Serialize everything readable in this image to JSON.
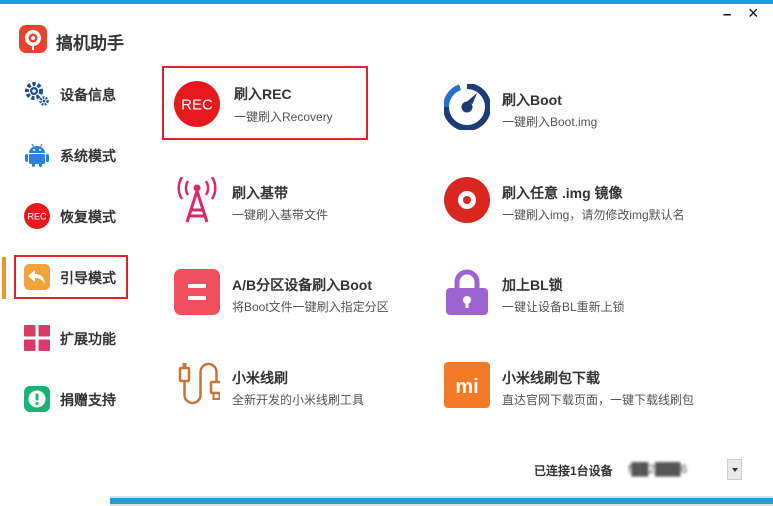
{
  "app": {
    "title": "搞机助手"
  },
  "window": {
    "minimize_label": "–",
    "close_label": "×"
  },
  "sidebar": {
    "items": [
      {
        "label": "设备信息",
        "icon": "gear-icon"
      },
      {
        "label": "系统模式",
        "icon": "android-icon"
      },
      {
        "label": "恢复模式",
        "icon": "rec-icon",
        "icon_text": "REC"
      },
      {
        "label": "引导模式",
        "icon": "back-arrow-icon",
        "active": true
      },
      {
        "label": "扩展功能",
        "icon": "grid-icon"
      },
      {
        "label": "捐赠支持",
        "icon": "info-icon"
      }
    ]
  },
  "cards": [
    {
      "title": "刷入REC",
      "desc": "一键刷入Recovery",
      "icon": "rec-icon",
      "icon_text": "REC",
      "selected": true
    },
    {
      "title": "刷入Boot",
      "desc": "一键刷入Boot.img",
      "icon": "boot-icon"
    },
    {
      "title": "刷入基带",
      "desc": "一键刷入基带文件",
      "icon": "antenna-icon"
    },
    {
      "title": "刷入任意 .img 镜像",
      "desc": "一键刷入img，请勿修改img默认名",
      "icon": "disc-icon"
    },
    {
      "title": "A/B分区设备刷入Boot",
      "desc": "将Boot文件一键刷入指定分区",
      "icon": "partition-icon"
    },
    {
      "title": "加上BL锁",
      "desc": "一键让设备BL重新上锁",
      "icon": "lock-icon"
    },
    {
      "title": "小米线刷",
      "desc": "全新开发的小米线刷工具",
      "icon": "usb-cable-icon"
    },
    {
      "title": "小米线刷包下载",
      "desc": "直达官网下载页面，一键下载线刷包",
      "icon": "mi-icon",
      "icon_text": "mi"
    }
  ],
  "status": {
    "connected_text": "已连接1台设备",
    "device_value": "f██2███6"
  },
  "progress": {
    "value": 1.0
  },
  "colors": {
    "accent_blue": "#1aa0d8",
    "selection_red": "#d8262c",
    "rec_red": "#e8191e",
    "antenna_pink": "#d92a6b",
    "partition_red": "#ef4f5f",
    "lock_purple": "#9c64d2",
    "mi_orange": "#f47a27",
    "cable_orange": "#c8733a",
    "boot_navy": "#1c3d73",
    "sidebar_blue": "#1d4f91",
    "android_blue": "#2a82dd",
    "nav_orange": "#f0a33a",
    "grid_crimson": "#d83c66",
    "donate_green": "#16b475"
  }
}
